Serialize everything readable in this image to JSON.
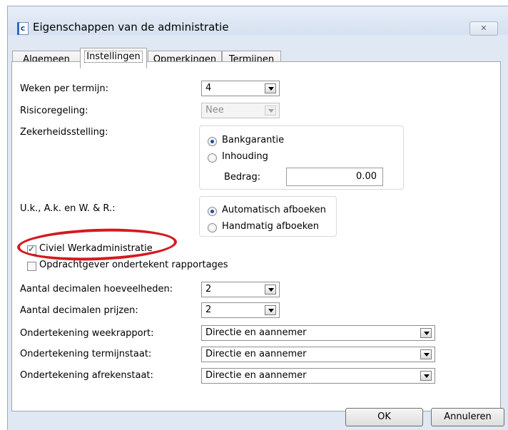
{
  "window": {
    "title": "Eigenschappen van de administratie",
    "icon_letter": "c",
    "close_glyph": "✕"
  },
  "tabs": [
    {
      "label": "Algemeen"
    },
    {
      "label": "Instellingen"
    },
    {
      "label": "Opmerkingen"
    },
    {
      "label": "Termijnen"
    }
  ],
  "settings": {
    "weken_label": "Weken per termijn:",
    "weken_value": "4",
    "risico_label": "Risicoregeling:",
    "risico_value": "Nee",
    "zekerheid_label": "Zekerheidsstelling:",
    "zekerheid_options": [
      "Bankgarantie",
      "Inhouding"
    ],
    "bedrag_label": "Bedrag:",
    "bedrag_value": "0.00",
    "uk_label": "U.k., A.k. en W. & R.:",
    "uk_options": [
      "Automatisch afboeken",
      "Handmatig afboeken"
    ],
    "civiel_label": "Civiel Werkadministratie",
    "opdrachtgever_label": "Opdrachtgever ondertekent rapportages",
    "dec_hoeveel_label": "Aantal decimalen hoeveelheden:",
    "dec_hoeveel_value": "2",
    "dec_prijzen_label": "Aantal decimalen prijzen:",
    "dec_prijzen_value": "2",
    "weekrapport_label": "Ondertekening weekrapport:",
    "weekrapport_value": "Directie en aannemer",
    "termijnstaat_label": "Ondertekening termijnstaat:",
    "termijnstaat_value": "Directie en aannemer",
    "afrekenstaat_label": "Ondertekening afrekenstaat:",
    "afrekenstaat_value": "Directie en aannemer"
  },
  "buttons": {
    "ok": "OK",
    "cancel": "Annuleren"
  },
  "colors": {
    "highlight_ellipse": "#d41a1f",
    "dialog_frame": "#dfe8f3"
  }
}
